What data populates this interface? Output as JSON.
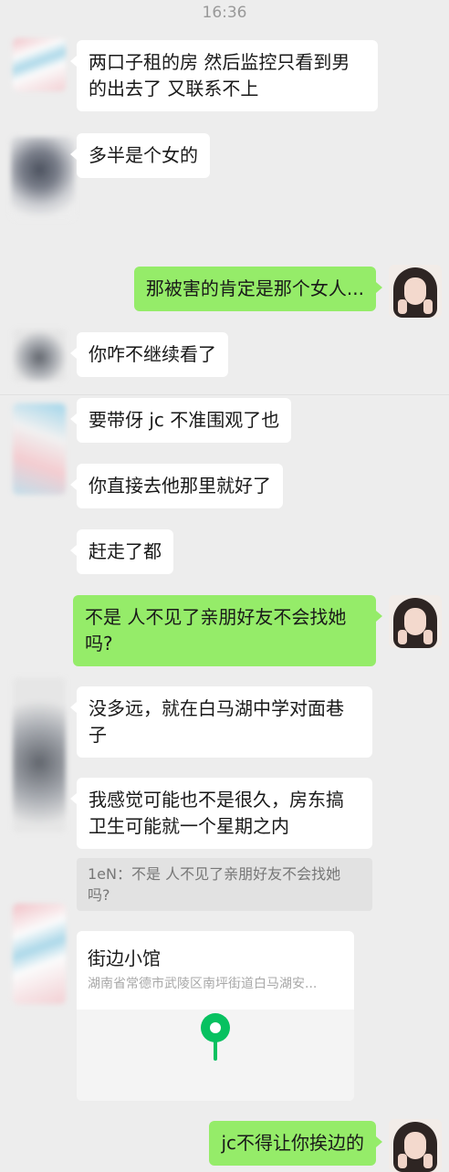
{
  "status": {
    "time": "16:36"
  },
  "messages": [
    {
      "from": "other",
      "text": "两口子租的房 然后监控只看到男\n的出去了 又联系不上"
    },
    {
      "from": "other",
      "text": "多半是个女的"
    },
    {
      "from": "self",
      "text": "那被害的肯定是那个女人..."
    },
    {
      "from": "other",
      "text": "你咋不继续看了"
    },
    {
      "from": "other",
      "text": "要带伢 jc 不准围观了也"
    },
    {
      "from": "other",
      "text": "你直接去他那里就好了"
    },
    {
      "from": "other",
      "text": "赶走了都"
    },
    {
      "from": "self",
      "text": "不是 人不见了亲朋好友不会找她\n吗?"
    },
    {
      "from": "other",
      "text": "没多远，就在白马湖中学对面巷\n子"
    },
    {
      "from": "other",
      "text": "我感觉可能也不是很久，房东搞\n卫生可能就一个星期之内"
    },
    {
      "from": "self",
      "text": "jc不得让你挨边的"
    }
  ],
  "quote": {
    "text": "1eN：不是 人不见了亲朋好友不会找她\n吗?"
  },
  "location": {
    "name": "街边小馆",
    "address": "湖南省常德市武陵区南坪街道白马湖安...",
    "pin_icon": "location-pin-icon"
  },
  "colors": {
    "background": "#ededed",
    "incoming_bubble": "#ffffff",
    "outgoing_bubble": "#95ec69",
    "pin": "#07c160"
  }
}
